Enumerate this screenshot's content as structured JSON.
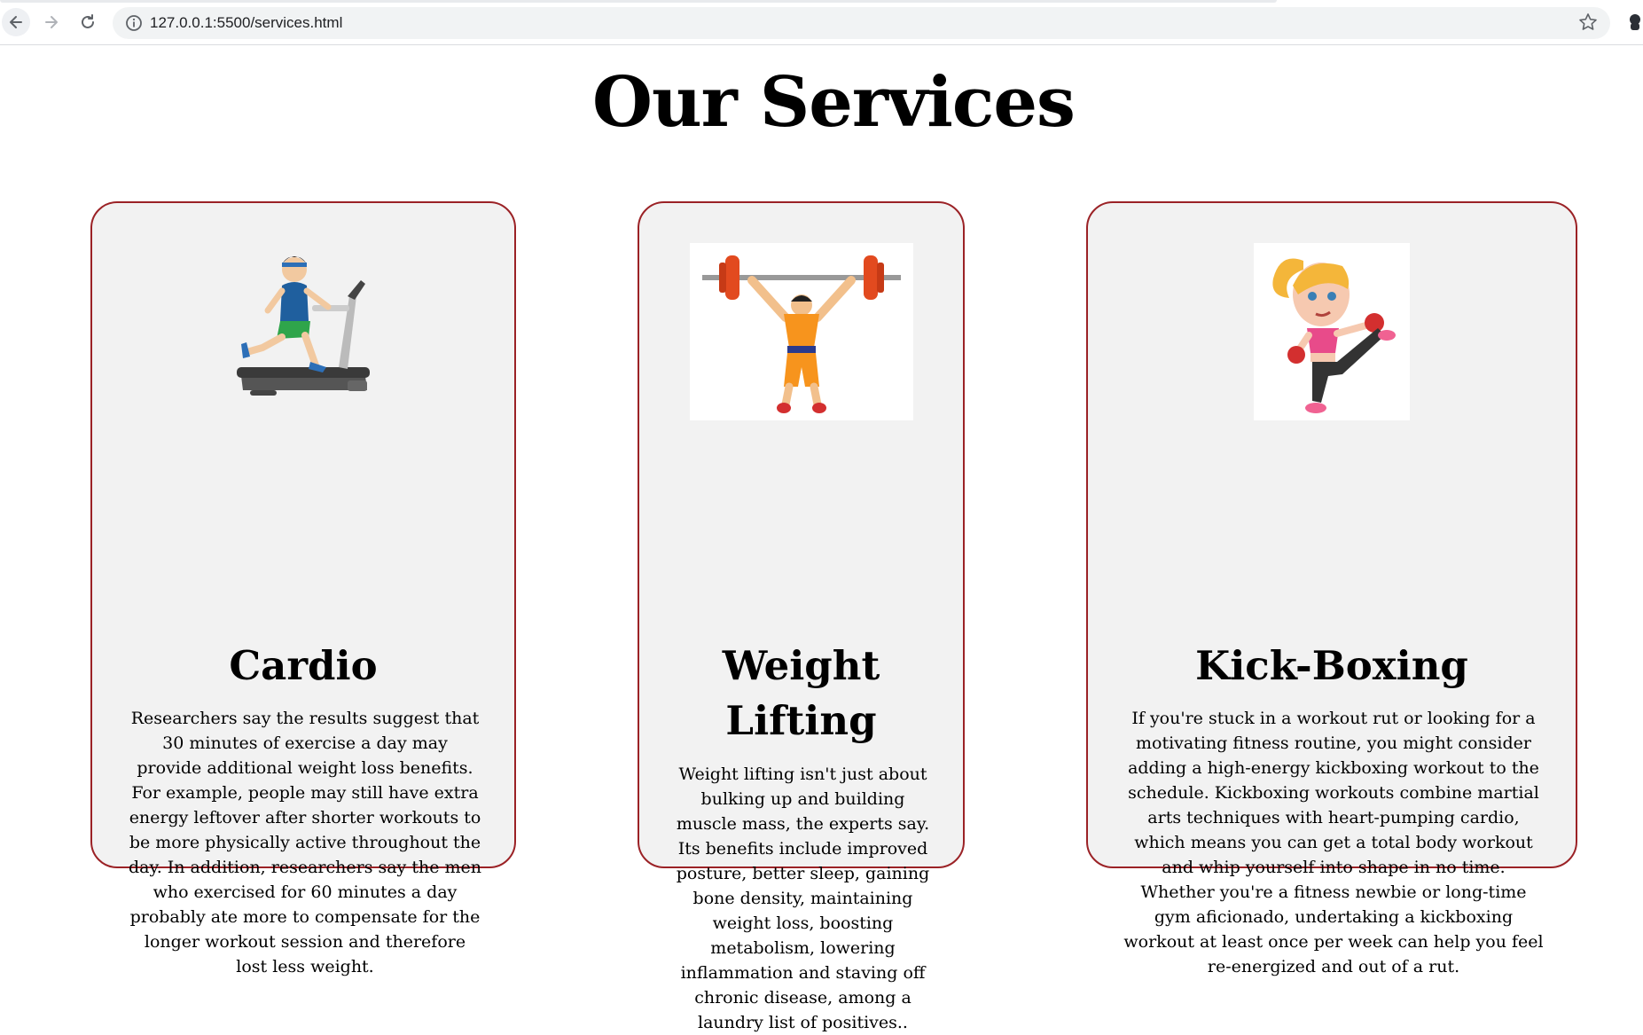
{
  "browser": {
    "url": "127.0.0.1:5500/services.html"
  },
  "page": {
    "title": "Our Services"
  },
  "cards": [
    {
      "title": "Cardio",
      "icon": "treadmill-runner",
      "text": "Researchers say the results suggest that 30 minutes of exercise a day may provide additional weight loss benefits. For example, people may still have extra energy leftover after shorter workouts to be more physically active throughout the day. In addition, researchers say the men who exercised for 60 minutes a day probably ate more to compensate for the longer workout session and therefore lost less weight."
    },
    {
      "title": "Weight Lifting",
      "icon": "weightlifter",
      "text": "Weight lifting isn't just about bulking up and building muscle mass, the experts say. Its benefits include improved posture, better sleep, gaining bone density, maintaining weight loss, boosting metabolism, lowering inflammation and staving off chronic disease, among a laundry list of positives.."
    },
    {
      "title": "Kick-Boxing",
      "icon": "kickboxer",
      "text": "If you're stuck in a workout rut or looking for a motivating fitness routine, you might consider adding a high-energy kickboxing workout to the schedule. Kickboxing workouts combine martial arts techniques with heart-pumping cardio, which means you can get a total body workout and whip yourself into shape in no time. Whether you're a fitness newbie or long-time gym aficionado, undertaking a kickboxing workout at least once per week can help you feel re-energized and out of a rut."
    }
  ],
  "colors": {
    "card_border": "#9b2226",
    "card_bg": "#f2f2f2"
  }
}
